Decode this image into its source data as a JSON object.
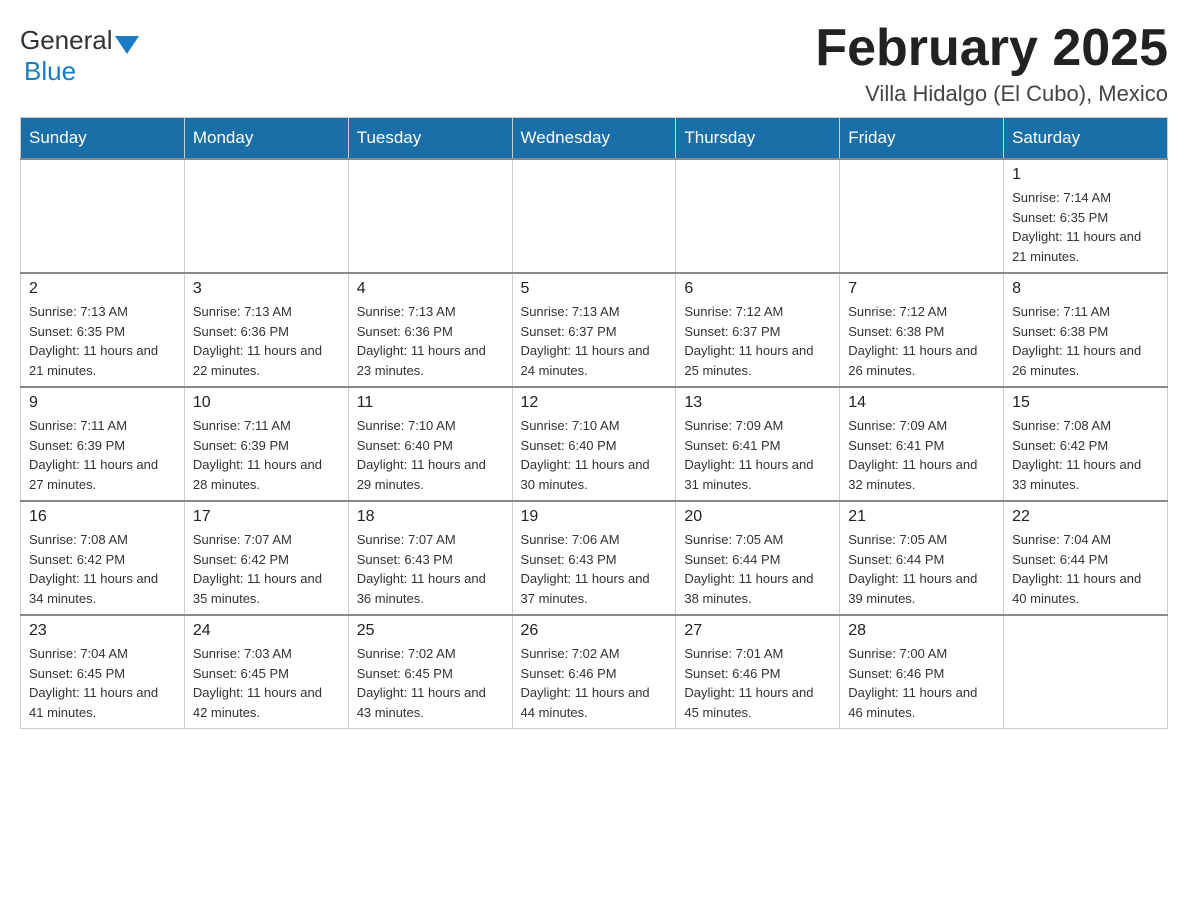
{
  "header": {
    "logo_general": "General",
    "logo_blue": "Blue",
    "month_title": "February 2025",
    "location": "Villa Hidalgo (El Cubo), Mexico"
  },
  "weekdays": [
    "Sunday",
    "Monday",
    "Tuesday",
    "Wednesday",
    "Thursday",
    "Friday",
    "Saturday"
  ],
  "weeks": [
    [
      {
        "day": "",
        "info": ""
      },
      {
        "day": "",
        "info": ""
      },
      {
        "day": "",
        "info": ""
      },
      {
        "day": "",
        "info": ""
      },
      {
        "day": "",
        "info": ""
      },
      {
        "day": "",
        "info": ""
      },
      {
        "day": "1",
        "info": "Sunrise: 7:14 AM\nSunset: 6:35 PM\nDaylight: 11 hours and 21 minutes."
      }
    ],
    [
      {
        "day": "2",
        "info": "Sunrise: 7:13 AM\nSunset: 6:35 PM\nDaylight: 11 hours and 21 minutes."
      },
      {
        "day": "3",
        "info": "Sunrise: 7:13 AM\nSunset: 6:36 PM\nDaylight: 11 hours and 22 minutes."
      },
      {
        "day": "4",
        "info": "Sunrise: 7:13 AM\nSunset: 6:36 PM\nDaylight: 11 hours and 23 minutes."
      },
      {
        "day": "5",
        "info": "Sunrise: 7:13 AM\nSunset: 6:37 PM\nDaylight: 11 hours and 24 minutes."
      },
      {
        "day": "6",
        "info": "Sunrise: 7:12 AM\nSunset: 6:37 PM\nDaylight: 11 hours and 25 minutes."
      },
      {
        "day": "7",
        "info": "Sunrise: 7:12 AM\nSunset: 6:38 PM\nDaylight: 11 hours and 26 minutes."
      },
      {
        "day": "8",
        "info": "Sunrise: 7:11 AM\nSunset: 6:38 PM\nDaylight: 11 hours and 26 minutes."
      }
    ],
    [
      {
        "day": "9",
        "info": "Sunrise: 7:11 AM\nSunset: 6:39 PM\nDaylight: 11 hours and 27 minutes."
      },
      {
        "day": "10",
        "info": "Sunrise: 7:11 AM\nSunset: 6:39 PM\nDaylight: 11 hours and 28 minutes."
      },
      {
        "day": "11",
        "info": "Sunrise: 7:10 AM\nSunset: 6:40 PM\nDaylight: 11 hours and 29 minutes."
      },
      {
        "day": "12",
        "info": "Sunrise: 7:10 AM\nSunset: 6:40 PM\nDaylight: 11 hours and 30 minutes."
      },
      {
        "day": "13",
        "info": "Sunrise: 7:09 AM\nSunset: 6:41 PM\nDaylight: 11 hours and 31 minutes."
      },
      {
        "day": "14",
        "info": "Sunrise: 7:09 AM\nSunset: 6:41 PM\nDaylight: 11 hours and 32 minutes."
      },
      {
        "day": "15",
        "info": "Sunrise: 7:08 AM\nSunset: 6:42 PM\nDaylight: 11 hours and 33 minutes."
      }
    ],
    [
      {
        "day": "16",
        "info": "Sunrise: 7:08 AM\nSunset: 6:42 PM\nDaylight: 11 hours and 34 minutes."
      },
      {
        "day": "17",
        "info": "Sunrise: 7:07 AM\nSunset: 6:42 PM\nDaylight: 11 hours and 35 minutes."
      },
      {
        "day": "18",
        "info": "Sunrise: 7:07 AM\nSunset: 6:43 PM\nDaylight: 11 hours and 36 minutes."
      },
      {
        "day": "19",
        "info": "Sunrise: 7:06 AM\nSunset: 6:43 PM\nDaylight: 11 hours and 37 minutes."
      },
      {
        "day": "20",
        "info": "Sunrise: 7:05 AM\nSunset: 6:44 PM\nDaylight: 11 hours and 38 minutes."
      },
      {
        "day": "21",
        "info": "Sunrise: 7:05 AM\nSunset: 6:44 PM\nDaylight: 11 hours and 39 minutes."
      },
      {
        "day": "22",
        "info": "Sunrise: 7:04 AM\nSunset: 6:44 PM\nDaylight: 11 hours and 40 minutes."
      }
    ],
    [
      {
        "day": "23",
        "info": "Sunrise: 7:04 AM\nSunset: 6:45 PM\nDaylight: 11 hours and 41 minutes."
      },
      {
        "day": "24",
        "info": "Sunrise: 7:03 AM\nSunset: 6:45 PM\nDaylight: 11 hours and 42 minutes."
      },
      {
        "day": "25",
        "info": "Sunrise: 7:02 AM\nSunset: 6:45 PM\nDaylight: 11 hours and 43 minutes."
      },
      {
        "day": "26",
        "info": "Sunrise: 7:02 AM\nSunset: 6:46 PM\nDaylight: 11 hours and 44 minutes."
      },
      {
        "day": "27",
        "info": "Sunrise: 7:01 AM\nSunset: 6:46 PM\nDaylight: 11 hours and 45 minutes."
      },
      {
        "day": "28",
        "info": "Sunrise: 7:00 AM\nSunset: 6:46 PM\nDaylight: 11 hours and 46 minutes."
      },
      {
        "day": "",
        "info": ""
      }
    ]
  ]
}
